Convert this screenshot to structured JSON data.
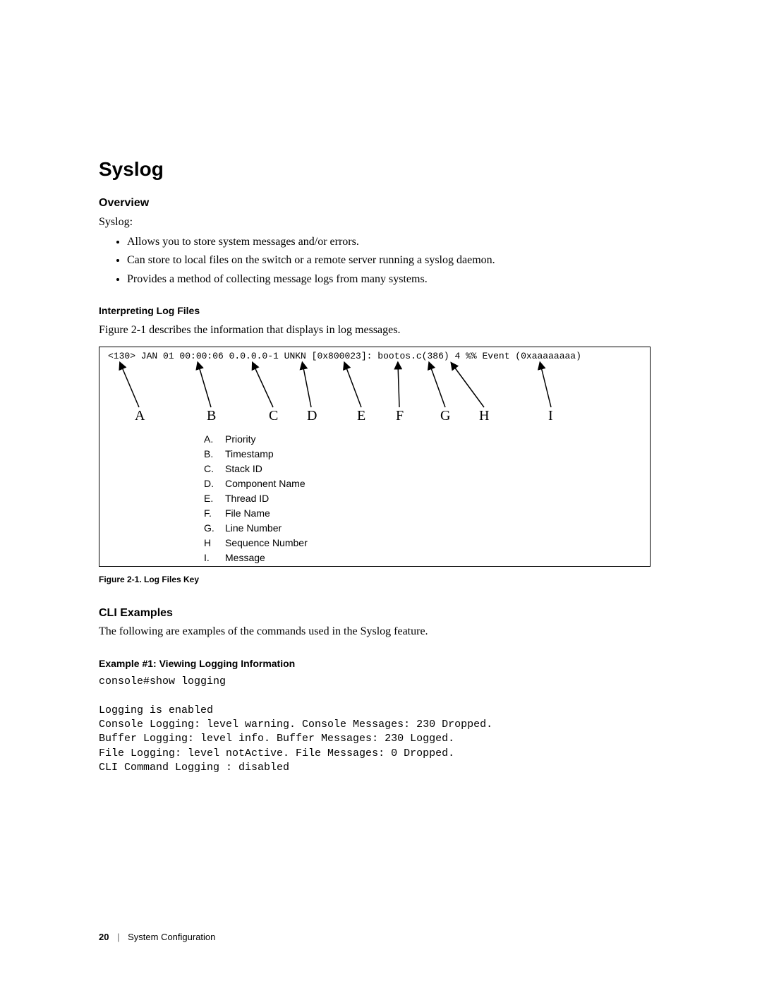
{
  "headings": {
    "title": "Syslog",
    "overview": "Overview",
    "interpreting": "Interpreting Log Files",
    "cli_examples": "CLI Examples",
    "example1": "Example #1: Viewing Logging Information"
  },
  "body": {
    "syslog_lead": "Syslog:",
    "bullets": {
      "b0": "Allows you to store system messages and/or errors.",
      "b1": "Can store to local files on the switch or a remote server running a syslog daemon.",
      "b2": "Provides a method of collecting message logs from many systems."
    },
    "fig_intro": "Figure 2-1 describes the information that displays in log messages.",
    "cli_intro": "The following are examples of the commands used in the Syslog feature."
  },
  "figure": {
    "caption": "Figure 2-1.    Log Files Key",
    "logline": "<130>  JAN  01  00:00:06  0.0.0.0-1  UNKN [0x800023]:  bootos.c(386)  4  %% Event (0xaaaaaaaa)",
    "labels": {
      "A": "A",
      "B": "B",
      "C": "C",
      "D": "D",
      "E": "E",
      "F": "F",
      "G": "G",
      "H": "H",
      "I": "I"
    },
    "legend": {
      "A": {
        "letter": "A.",
        "text": "Priority"
      },
      "B": {
        "letter": "B.",
        "text": "Timestamp"
      },
      "C": {
        "letter": "C.",
        "text": "Stack ID"
      },
      "D": {
        "letter": "D.",
        "text": "Component Name"
      },
      "E": {
        "letter": "E.",
        "text": "Thread ID"
      },
      "F": {
        "letter": "F.",
        "text": "File Name"
      },
      "G": {
        "letter": "G.",
        "text": "Line Number"
      },
      "H": {
        "letter": "H",
        "text": "Sequence Number"
      },
      "I": {
        "letter": "I.",
        "text": "Message"
      }
    }
  },
  "code": {
    "line0": "console#show logging",
    "line1": "",
    "line2": "Logging is enabled",
    "line3": "Console Logging: level warning. Console Messages: 230 Dropped.",
    "line4": "Buffer Logging: level info. Buffer Messages: 230 Logged.",
    "line5": "File Logging: level notActive. File Messages: 0 Dropped.",
    "line6": "CLI Command Logging : disabled"
  },
  "footer": {
    "page": "20",
    "section": "System Configuration"
  }
}
